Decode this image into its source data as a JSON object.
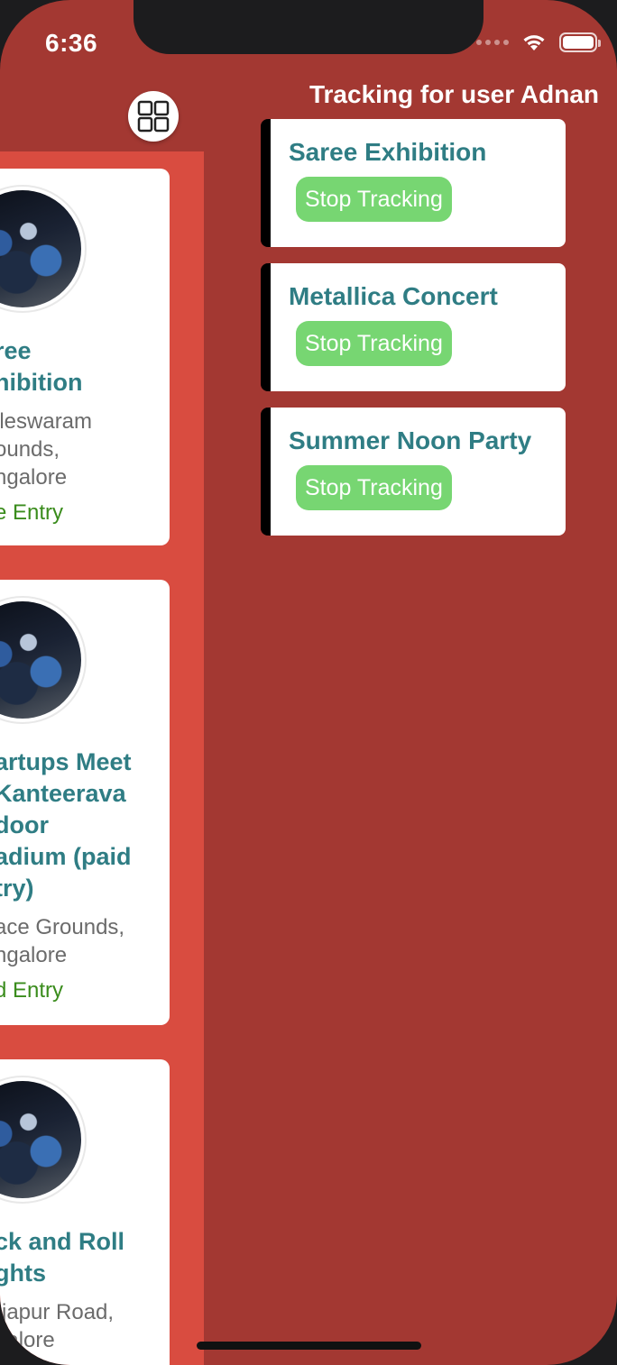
{
  "status_bar": {
    "time": "6:36"
  },
  "tracking": {
    "header": "Tracking for user Adnan",
    "items": [
      {
        "title": "Saree Exhibition",
        "button": "Stop Tracking"
      },
      {
        "title": "Metallica Concert",
        "button": "Stop Tracking"
      },
      {
        "title": "Summer Noon Party",
        "button": "Stop Tracking"
      }
    ]
  },
  "event_list": {
    "items": [
      {
        "title_lines": [
          "ree",
          "hibition"
        ],
        "venue_lines": [
          "lleswaram",
          "ounds,",
          "ngalore"
        ],
        "price": "e Entry"
      },
      {
        "title_lines": [
          "artups Meet",
          "Kanteerava",
          "door",
          "adium (paid",
          "try)"
        ],
        "venue_lines": [
          "ace Grounds,",
          "ngalore"
        ],
        "price": "d Entry"
      },
      {
        "title_lines": [
          "ck and Roll",
          "ghts"
        ],
        "venue_lines": [
          "rjapur Road,",
          "galore"
        ],
        "price": ""
      }
    ]
  },
  "colors": {
    "background": "#a33832",
    "list_panel": "#d94c40",
    "title_teal": "#2f7d84",
    "button_green": "#77d672",
    "price_green": "#3a8c1c"
  },
  "icons": {
    "grid_toggle": "grid-icon",
    "wifi": "wifi-icon",
    "battery": "battery-icon",
    "signal": "signal-icon"
  }
}
